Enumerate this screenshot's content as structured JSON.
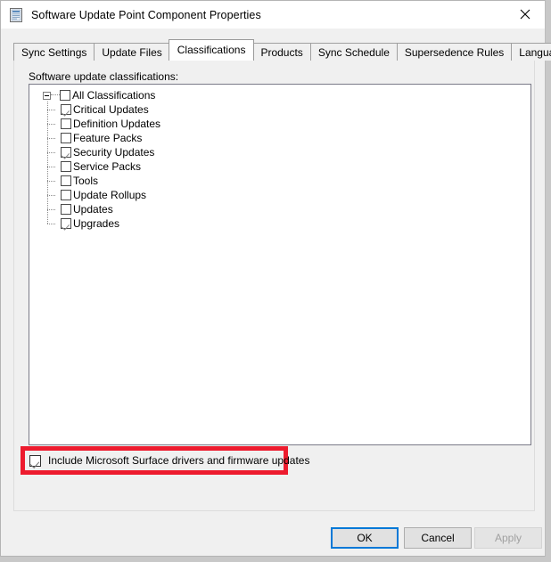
{
  "window": {
    "title": "Software Update Point Component Properties",
    "icon": "properties-window-icon",
    "close_label": "✕"
  },
  "tabs": [
    {
      "label": "Sync Settings",
      "active": false
    },
    {
      "label": "Update Files",
      "active": false
    },
    {
      "label": "Classifications",
      "active": true
    },
    {
      "label": "Products",
      "active": false
    },
    {
      "label": "Sync Schedule",
      "active": false
    },
    {
      "label": "Supersedence Rules",
      "active": false
    },
    {
      "label": "Languages",
      "active": false
    }
  ],
  "classifications_page": {
    "field_label": "Software update classifications:",
    "tree": {
      "root": {
        "label": "All Classifications",
        "checked": false,
        "expanded": true
      },
      "children": [
        {
          "label": "Critical Updates",
          "checked": true
        },
        {
          "label": "Definition Updates",
          "checked": false
        },
        {
          "label": "Feature Packs",
          "checked": false
        },
        {
          "label": "Security Updates",
          "checked": true
        },
        {
          "label": "Service Packs",
          "checked": false
        },
        {
          "label": "Tools",
          "checked": false
        },
        {
          "label": "Update Rollups",
          "checked": false
        },
        {
          "label": "Updates",
          "checked": false
        },
        {
          "label": "Upgrades",
          "checked": true
        }
      ]
    },
    "surface_option": {
      "label": "Include Microsoft Surface drivers and firmware updates",
      "checked": true,
      "highlight_color": "#ed1b2e"
    }
  },
  "footer": {
    "ok_label": "OK",
    "cancel_label": "Cancel",
    "apply_label": "Apply",
    "accent_color": "#0078d7"
  }
}
